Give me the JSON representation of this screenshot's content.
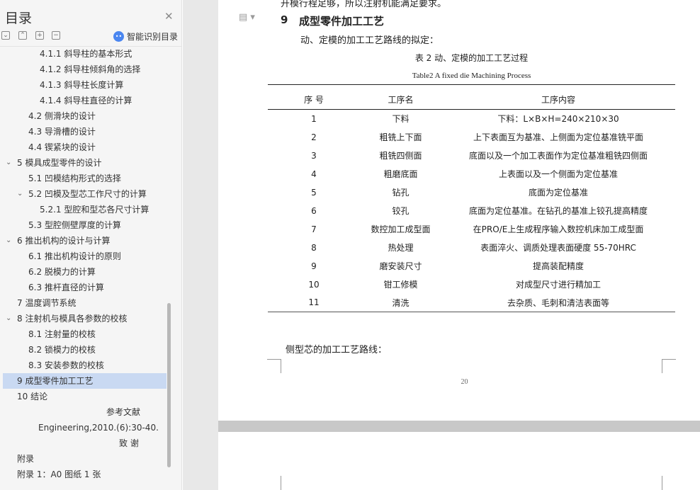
{
  "sidebar": {
    "title": "目录",
    "close_icon": "close-icon",
    "toolbar": {
      "collapse_all": "collapse-icon",
      "expand_up": "chevron-up-icon",
      "add": "plus-icon",
      "remove": "minus-icon",
      "smart_toc_label": "智能识别目录"
    },
    "items": [
      {
        "label": "4.1.1   斜导柱的基本形式",
        "level": 3
      },
      {
        "label": "4.1.2   斜导柱倾斜角的选择",
        "level": 3
      },
      {
        "label": "4.1.3   斜导柱长度计算",
        "level": 3
      },
      {
        "label": "4.1.4   斜导柱直径的计算",
        "level": 3
      },
      {
        "label": "4.2   侧滑块的设计",
        "level": 2
      },
      {
        "label": "4.3   导滑槽的设计",
        "level": 2
      },
      {
        "label": "4.4   锲紧块的设计",
        "level": 2
      },
      {
        "label": "5   模具成型零件的设计",
        "level": 1,
        "expanded": true
      },
      {
        "label": "5.1   凹模结构形式的选择",
        "level": 2
      },
      {
        "label": "5.2   凹模及型芯工作尺寸的计算",
        "level": 2,
        "expanded": true
      },
      {
        "label": "5.2.1   型腔和型芯各尺寸计算",
        "level": 3
      },
      {
        "label": "5.3   型腔侧壁厚度的计算",
        "level": 2
      },
      {
        "label": "6   推出机构的设计与计算",
        "level": 1,
        "expanded": true
      },
      {
        "label": "6.1   推出机构设计的原则",
        "level": 2
      },
      {
        "label": "6.2   脱模力的计算",
        "level": 2
      },
      {
        "label": "6.3   推杆直径的计算",
        "level": 2
      },
      {
        "label": "7   温度调节系统",
        "level": 1
      },
      {
        "label": "8   注射机与模具各参数的校核",
        "level": 1,
        "expanded": true
      },
      {
        "label": "8.1   注射量的校核",
        "level": 2
      },
      {
        "label": "8.2   锁模力的校核",
        "level": 2
      },
      {
        "label": "8.3   安装参数的校核",
        "level": 2
      },
      {
        "label": "9   成型零件加工工艺",
        "level": 1,
        "active": true
      },
      {
        "label": "10   结论",
        "level": 1
      },
      {
        "label": "参考文献",
        "level": 0
      },
      {
        "label": "Engineering,2010.(6):30-40.",
        "level": 0
      },
      {
        "label": "致      谢",
        "level": 0
      },
      {
        "label": "附录",
        "level": 1
      },
      {
        "label": "附录 1：A0 图纸 1 张",
        "level": 1
      }
    ]
  },
  "document": {
    "top_line": "开模行程足够，所以注射机能满足要求。",
    "section_number": "9",
    "section_title": "成型零件加工工艺",
    "intro": "动、定模的加工工艺路线的拟定：",
    "caption_cn": "表 2   动、定模的加工工艺过程",
    "caption_en": "Table2    A fixed die Machining Process",
    "table": {
      "headers": [
        "序   号",
        "工序名",
        "工序内容"
      ],
      "rows": [
        [
          "1",
          "下料",
          "下料：L×B×H=240×210×30"
        ],
        [
          "2",
          "粗铣上下面",
          "上下表面互为基准、上侧面为定位基准铣平面"
        ],
        [
          "3",
          "粗铣四侧面",
          "底面以及一个加工表面作为定位基准粗铣四侧面"
        ],
        [
          "4",
          "粗磨底面",
          "上表面以及一个侧面为定位基准"
        ],
        [
          "5",
          "钻孔",
          "底面为定位基准"
        ],
        [
          "6",
          "铰孔",
          "底面为定位基准。在钻孔的基准上铰孔提高精度"
        ],
        [
          "7",
          "数控加工成型面",
          "在PRO/E上生成程序输入数控机床加工成型面"
        ],
        [
          "8",
          "热处理",
          "表面淬火、调质处理表面硬度 55-70HRC"
        ],
        [
          "9",
          "磨安装尺寸",
          "提高装配精度"
        ],
        [
          "10",
          "钳工修模",
          "对成型尺寸进行精加工"
        ],
        [
          "11",
          "清洗",
          "去杂质、毛刺和清洁表面等"
        ]
      ]
    },
    "follow_text": "侧型芯的加工工艺路线：",
    "page_number": "20",
    "doc_icon": "document-icon"
  }
}
